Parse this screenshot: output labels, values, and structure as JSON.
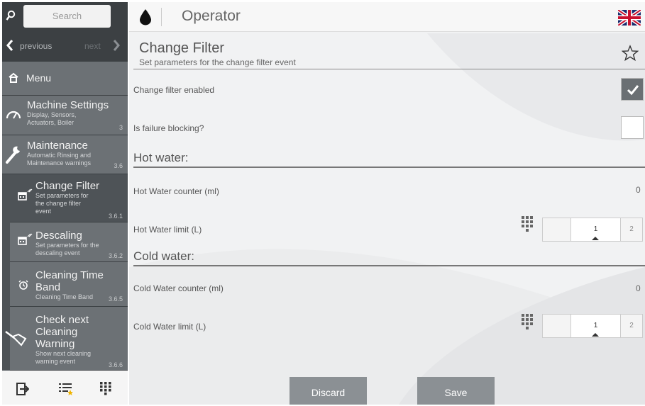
{
  "sidebar": {
    "search": {
      "placeholder": "Search"
    },
    "nav": {
      "previous": "previous",
      "next": "next"
    },
    "menu_label": "Menu",
    "items": [
      {
        "title": "Machine Settings",
        "subtitle": "Display, Sensors, Actuators, Boiler",
        "number": "3"
      },
      {
        "title": "Maintenance",
        "subtitle": "Automatic Rinsing and Maintenance warnings",
        "number": "3.6"
      },
      {
        "title": "Change Filter",
        "subtitle": "Set parameters for the change filter event",
        "number": "3.6.1"
      },
      {
        "title": "Descaling",
        "subtitle": "Set parameters for the descaling event",
        "number": "3.6.2"
      },
      {
        "title": "Cleaning Time Band",
        "subtitle": "Cleaning Time Band",
        "number": "3.6.5"
      },
      {
        "title": "Check next Cleaning Warning",
        "subtitle": "Show next cleaning warning event",
        "number": "3.6.6"
      }
    ]
  },
  "header": {
    "title": "Operator"
  },
  "page": {
    "title": "Change Filter",
    "subtitle": "Set parameters for the change filter event"
  },
  "rows": {
    "change_filter_enabled": {
      "label": "Change filter enabled",
      "checked": true
    },
    "is_failure_blocking": {
      "label": "Is failure blocking?",
      "checked": false
    }
  },
  "hot_water": {
    "heading": "Hot water:",
    "counter_label": "Hot Water counter (ml)",
    "counter_value": "0",
    "limit_label": "Hot Water limit (L)",
    "limit_value": "1",
    "limit_next": "2"
  },
  "cold_water": {
    "heading": "Cold water:",
    "counter_label": "Cold Water counter (ml)",
    "counter_value": "0",
    "limit_label": "Cold Water limit (L)",
    "limit_value": "1",
    "limit_next": "2"
  },
  "buttons": {
    "discard": "Discard",
    "save": "Save"
  },
  "colors": {
    "sidebar_bg": "#4e5357",
    "sidebar_dark": "#3c4043",
    "selected_item": "#6c7175",
    "button": "#8b9094"
  }
}
